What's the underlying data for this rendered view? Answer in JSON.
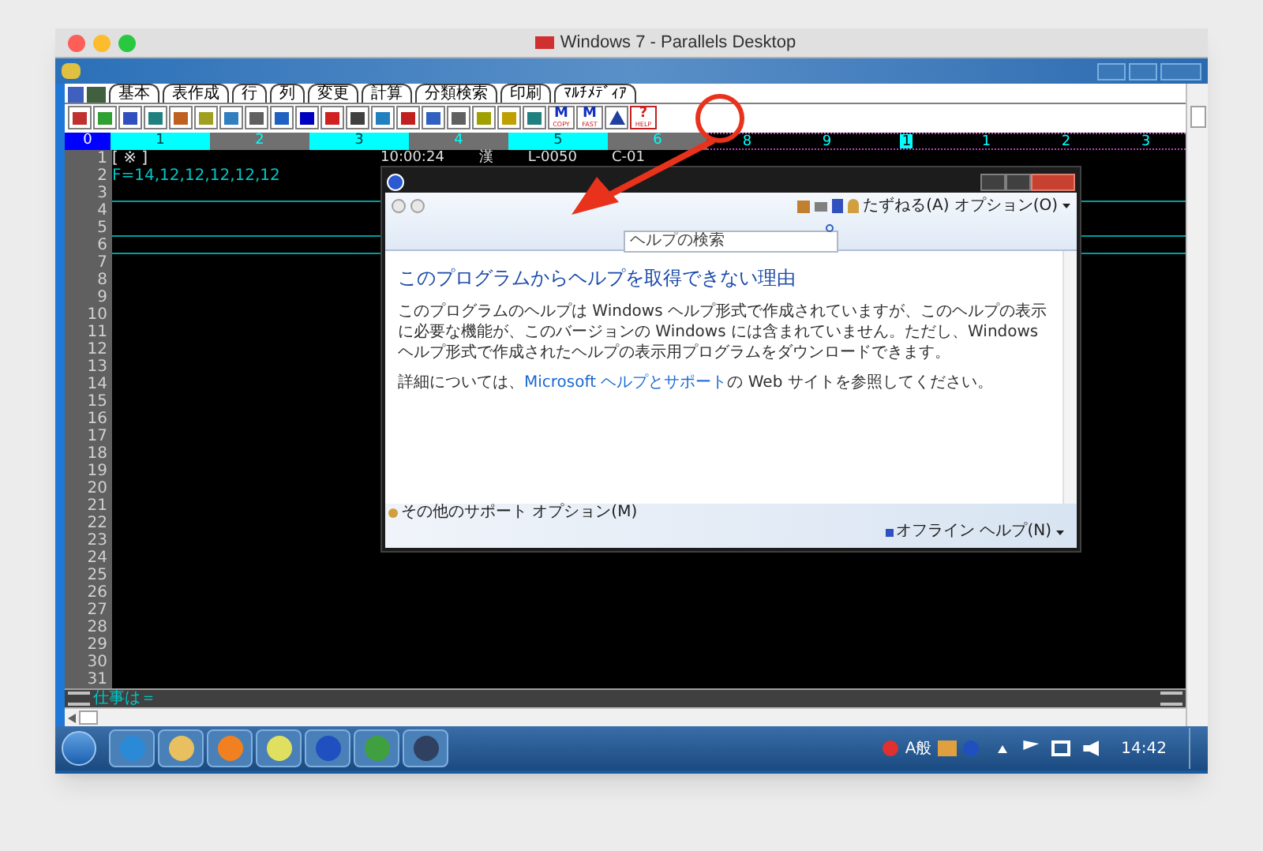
{
  "mac_window": {
    "title": "Windows 7 - Parallels Desktop"
  },
  "app": {
    "tabs": [
      {
        "label": "基本"
      },
      {
        "label": "表作成"
      },
      {
        "label": "行"
      },
      {
        "label": "列"
      },
      {
        "label": "変更"
      },
      {
        "label": "計算"
      },
      {
        "label": "分類検索"
      },
      {
        "label": "印刷"
      },
      {
        "label": "ﾏﾙﾁﾒﾃﾞｨｱ"
      }
    ],
    "text_tools": [
      {
        "glyph": "M",
        "caption": "COPY"
      },
      {
        "glyph": "M",
        "caption": "FAST"
      },
      {
        "glyph": "?",
        "caption": "HELP"
      }
    ],
    "ruler": {
      "blocks": [
        {
          "label": "0",
          "selected": true
        },
        {
          "label": "1",
          "selected": false
        },
        {
          "label": "2",
          "selected": false
        },
        {
          "label": "3",
          "selected": false
        },
        {
          "label": "4",
          "selected": false
        },
        {
          "label": "5",
          "selected": false
        },
        {
          "label": "6",
          "selected": false
        }
      ],
      "marks": [
        {
          "label": "8",
          "selected": false
        },
        {
          "label": "9",
          "selected": false
        },
        {
          "label": "1",
          "selected": true
        },
        {
          "label": "1",
          "selected": false
        },
        {
          "label": "2",
          "selected": false
        },
        {
          "label": "3",
          "selected": false
        }
      ]
    },
    "header_info": [
      "10:00:24",
      "漢",
      "L-0050",
      "C-01"
    ],
    "line_numbers": [
      "1",
      "2",
      "3",
      "4",
      "5",
      "6",
      "7",
      "8",
      "9",
      "10",
      "11",
      "12",
      "13",
      "14",
      "15",
      "16",
      "17",
      "18",
      "19",
      "20",
      "21",
      "22",
      "23",
      "24",
      "25",
      "26",
      "27",
      "28",
      "29",
      "30",
      "31"
    ],
    "lines": [
      "[ ※ ]",
      "F=14,12,12,12,12,12"
    ],
    "status": "仕事は＝"
  },
  "help_dialog": {
    "ask": "たずねる(A)",
    "options": "オプション(O)",
    "search": {
      "placeholder": "ヘルプの検索"
    },
    "heading": "このプログラムからヘルプを取得できない理由",
    "paragraph": "このプログラムのヘルプは Windows ヘルプ形式で作成されていますが、このヘルプの表示に必要な機能が、このバージョンの Windows には含まれていません。ただし、Windows ヘルプ形式で作成されたヘルプの表示用プログラムをダウンロードできます。",
    "details_before": "詳細については、",
    "details_link": "Microsoft ヘルプとサポート",
    "details_after": "の Web サイトを参照してください。",
    "support": "その他のサポート オプション(M)",
    "offline": "オフライン ヘルプ(N)"
  },
  "taskbar": {
    "ime": "A般",
    "clock": "14:42"
  }
}
